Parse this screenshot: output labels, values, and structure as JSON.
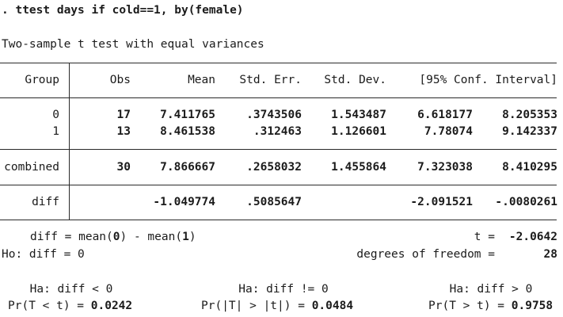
{
  "command": ". ttest days if cold==1, by(female)",
  "test_title": "Two-sample t test with equal variances",
  "columns": {
    "group": "Group",
    "obs": "Obs",
    "mean": "Mean",
    "std_err": "Std. Err.",
    "std_dev": "Std. Dev.",
    "conf_interval": "[95% Conf. Interval]"
  },
  "rows": [
    {
      "group": "0",
      "obs": "17",
      "mean": "7.411765",
      "std_err": ".3743506",
      "std_dev": "1.543487",
      "ci_low": "6.618177",
      "ci_high": "8.205353"
    },
    {
      "group": "1",
      "obs": "13",
      "mean": "8.461538",
      "std_err": ".312463",
      "std_dev": "1.126601",
      "ci_low": "7.78074",
      "ci_high": "9.142337"
    }
  ],
  "combined": {
    "group": "combined",
    "obs": "30",
    "mean": "7.866667",
    "std_err": ".2658032",
    "std_dev": "1.455864",
    "ci_low": "7.323038",
    "ci_high": "8.410295"
  },
  "diff": {
    "group": "diff",
    "mean": "-1.049774",
    "std_err": ".5085647",
    "ci_low": "-2.091521",
    "ci_high": "-.0080261"
  },
  "summary": {
    "diff_def_prefix": "diff = mean(",
    "diff_def_g0": "0",
    "diff_def_mid": ") - mean(",
    "diff_def_g1": "1",
    "diff_def_suffix": ")",
    "t_label": "t =",
    "t_value": "-2.0642",
    "ho": "Ho: diff = 0",
    "df_label": "degrees of freedom =",
    "df_value": "28"
  },
  "hypotheses": {
    "left": {
      "ha": "Ha: diff < 0",
      "p_label": "Pr(T < t) =",
      "p_value": "0.0242"
    },
    "mid": {
      "ha": "Ha: diff != 0",
      "p_label": "Pr(|T| > |t|) =",
      "p_value": "0.0484"
    },
    "right": {
      "ha": "Ha: diff > 0",
      "p_label": "Pr(T > t) =",
      "p_value": "0.9758"
    }
  }
}
